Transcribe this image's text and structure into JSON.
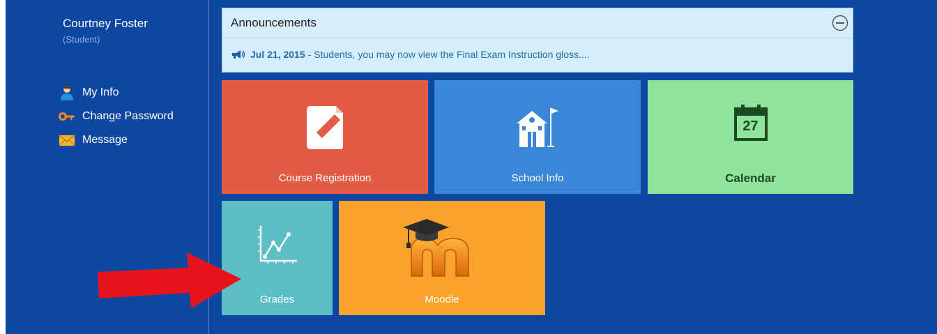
{
  "user": {
    "name": "Courtney Foster",
    "role": "(Student)"
  },
  "sidebar": {
    "items": [
      {
        "label": "My Info",
        "icon": "person-icon"
      },
      {
        "label": "Change Password",
        "icon": "key-icon"
      },
      {
        "label": "Message",
        "icon": "envelope-icon"
      }
    ]
  },
  "announcements": {
    "title": "Announcements",
    "item": {
      "date": "Jul 21, 2015",
      "separator": "-",
      "text": "Students, you may now view the Final Exam Instruction gloss...."
    }
  },
  "tiles": {
    "course_registration": {
      "label": "Course Registration",
      "icon": "document-pencil-icon"
    },
    "school_info": {
      "label": "School Info",
      "icon": "school-building-icon"
    },
    "calendar": {
      "label": "Calendar",
      "icon": "calendar-icon",
      "day": "27"
    },
    "grades": {
      "label": "Grades",
      "icon": "line-chart-icon"
    },
    "moodle": {
      "label": "Moodle",
      "icon": "moodle-logo"
    }
  },
  "colors": {
    "page_background": "#0d47a1",
    "course_tile": "#e45b45",
    "school_tile": "#3a87d8",
    "calendar_tile": "#8fe39b",
    "grades_tile": "#5bbec5",
    "moodle_tile": "#faa32b",
    "pointer_arrow": "#e8141b"
  }
}
